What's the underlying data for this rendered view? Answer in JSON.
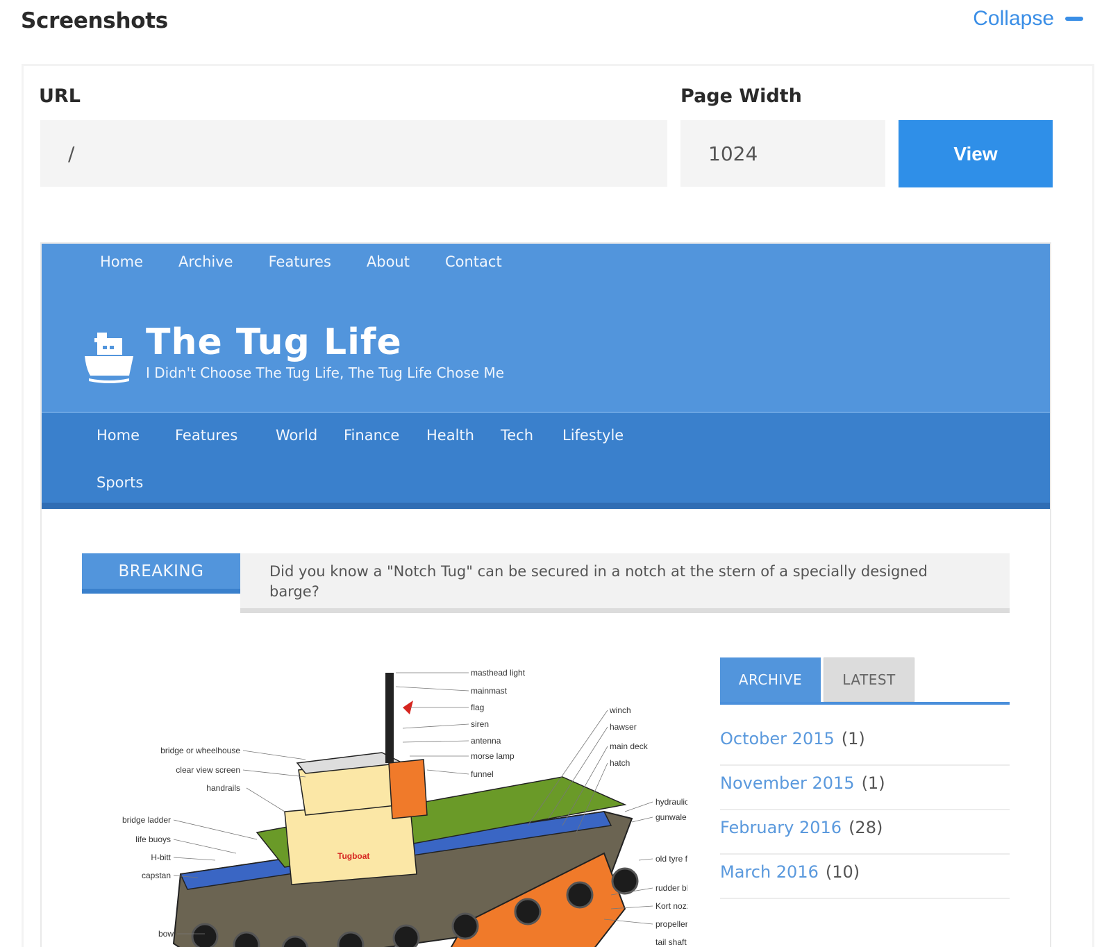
{
  "header": {
    "title": "Screenshots",
    "collapse_label": "Collapse"
  },
  "form": {
    "url_label": "URL",
    "url_value": "/",
    "width_label": "Page Width",
    "width_value": "1024",
    "view_label": "View"
  },
  "preview": {
    "top_nav": [
      "Home",
      "Archive",
      "Features",
      "About",
      "Contact"
    ],
    "site_name": "The Tug Life",
    "tagline": "I Didn't Choose The Tug Life, The Tug Life Chose Me",
    "main_nav": [
      "Home",
      "Features",
      "World",
      "Finance",
      "Health",
      "Tech",
      "Lifestyle",
      "Sports"
    ],
    "breaking_label": "BREAKING",
    "breaking_text": "Did you know a \"Notch Tug\" can be secured in a notch at the stern of a specially designed barge?",
    "diagram": {
      "boat_name": "Tugboat",
      "labels_right_top": [
        "masthead light",
        "mainmast",
        "flag",
        "siren",
        "antenna",
        "morse lamp",
        "funnel"
      ],
      "labels_right_mid": [
        "winch",
        "hawser",
        "main deck",
        "hatch"
      ],
      "labels_right_low": [
        "hydraulic pins",
        "gunwale",
        "old tyre fender",
        "rudder blade",
        "Kort nozzle",
        "propeller",
        "tail shaft"
      ],
      "labels_left": [
        "bridge or wheelhouse",
        "clear view screen",
        "handrails",
        "bridge ladder",
        "life buoys",
        "H-bitt",
        "capstan",
        "bow"
      ]
    },
    "tabs": {
      "archive": "ARCHIVE",
      "latest": "LATEST"
    },
    "archive": [
      {
        "month": "October 2015",
        "count": "(1)"
      },
      {
        "month": "November 2015",
        "count": "(1)"
      },
      {
        "month": "February 2016",
        "count": "(28)"
      },
      {
        "month": "March 2016",
        "count": "(10)"
      }
    ]
  },
  "colors": {
    "accent": "#2f8fe8",
    "header_blue": "#5295dc",
    "nav_blue": "#3a80cc"
  }
}
